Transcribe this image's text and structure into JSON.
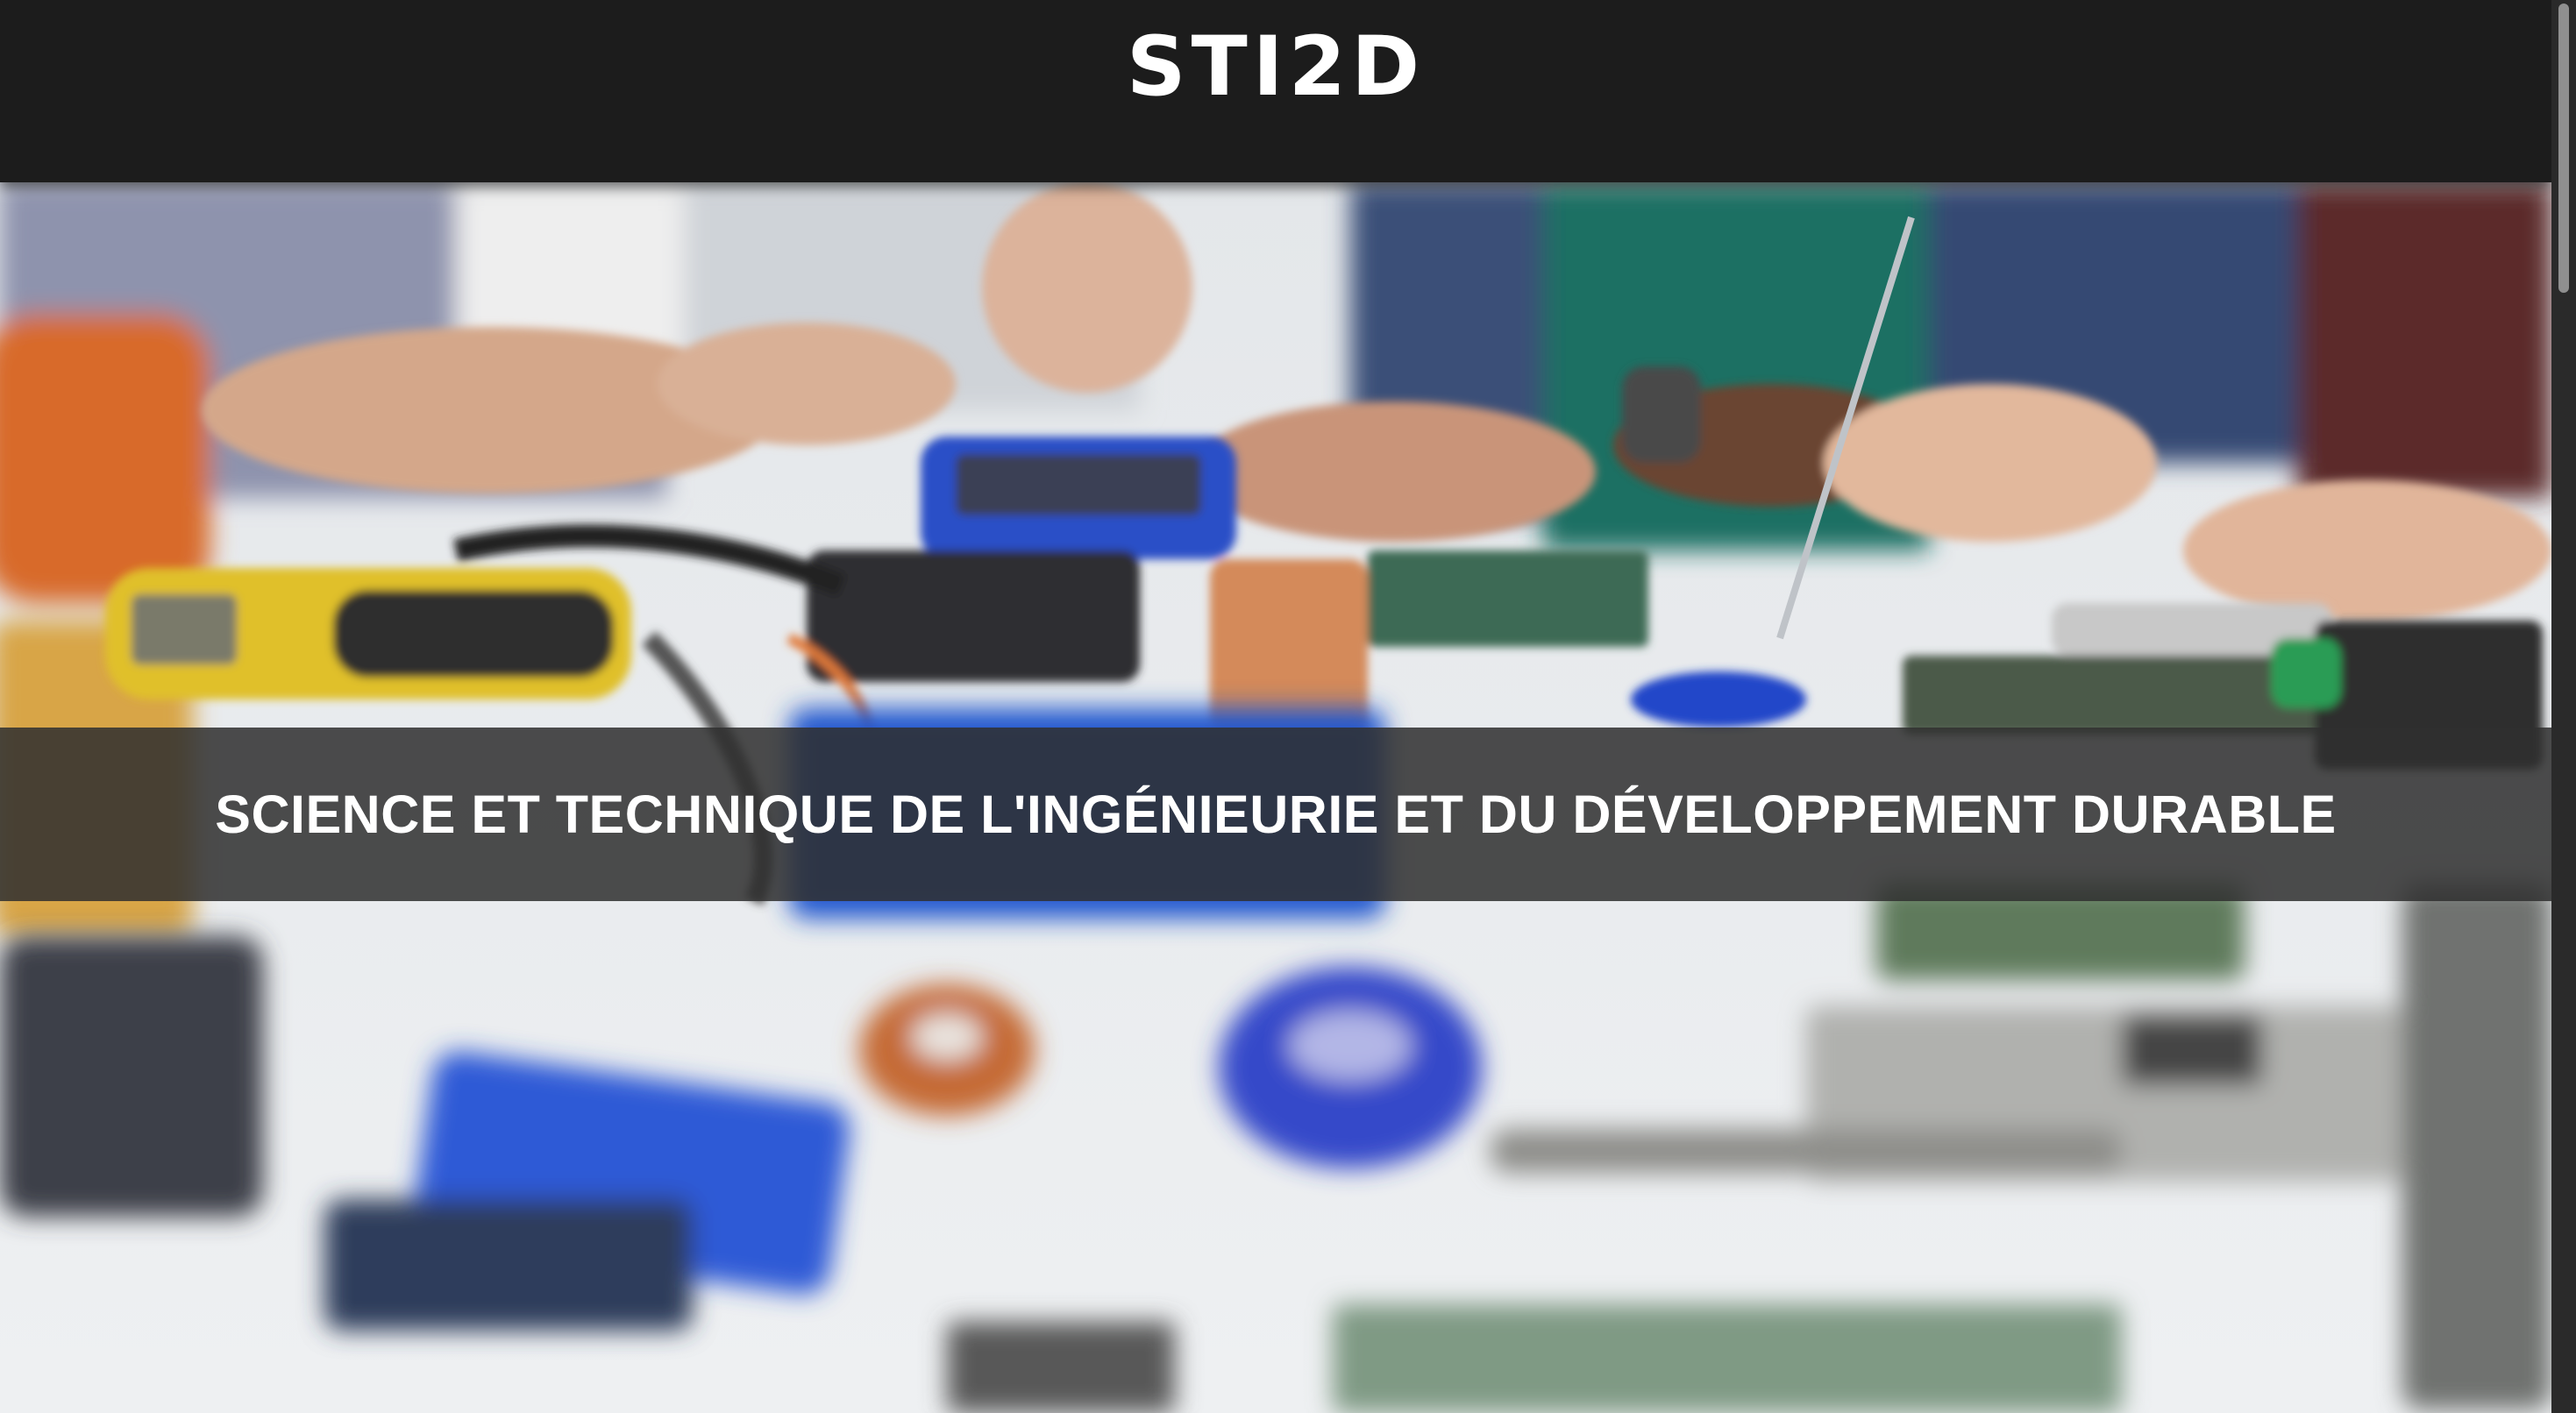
{
  "header": {
    "title": "STI2D"
  },
  "hero": {
    "image_description_icon": "electronics-workbench-photo",
    "banner_text": "SCIENCE ET TECHNIQUE DE L'INGÉNIEURIE ET DU DÉVELOPPEMENT DURABLE"
  },
  "colors": {
    "header_bg": "#1c1c1c",
    "banner_bg": "#303030",
    "text": "#ffffff"
  }
}
